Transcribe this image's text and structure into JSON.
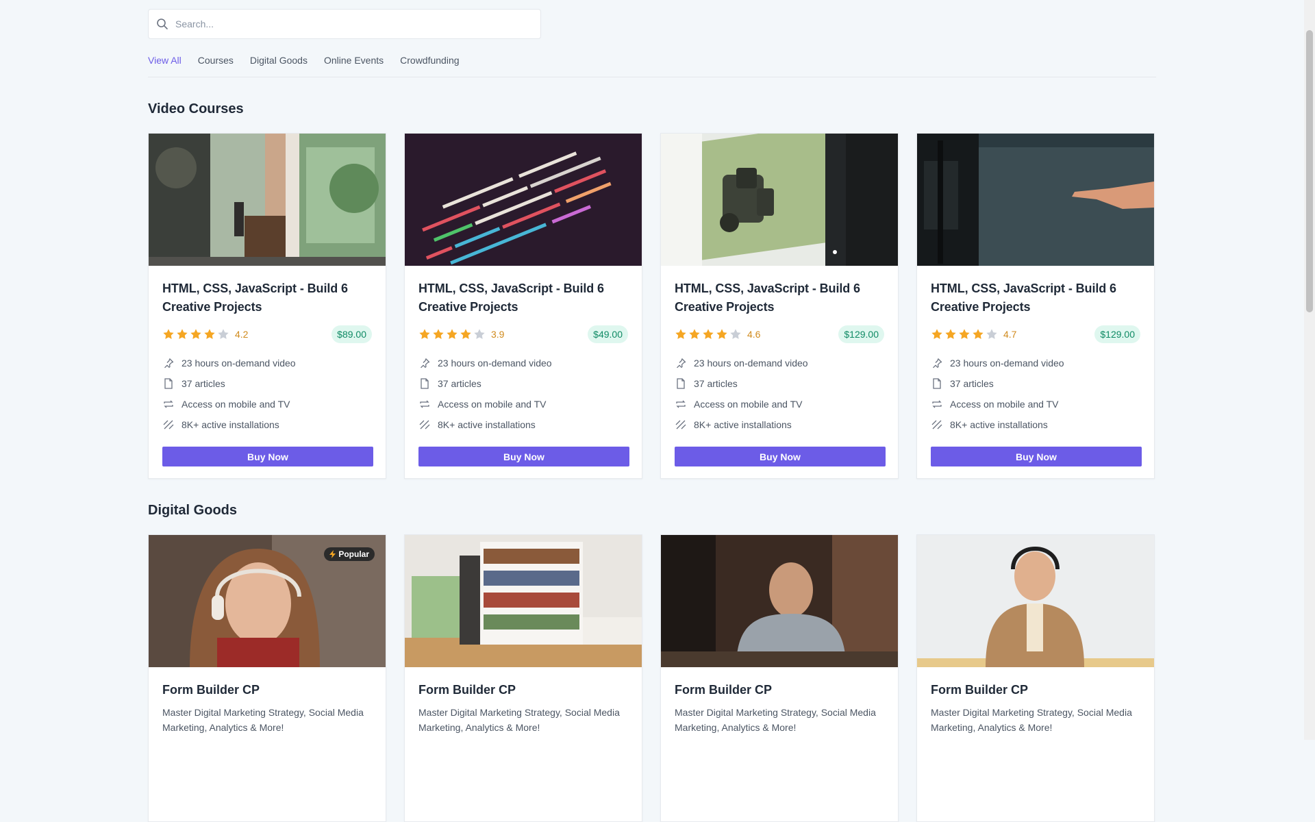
{
  "search": {
    "placeholder": "Search..."
  },
  "tabs": [
    {
      "label": "View All",
      "active": true
    },
    {
      "label": "Courses",
      "active": false
    },
    {
      "label": "Digital Goods",
      "active": false
    },
    {
      "label": "Online Events",
      "active": false
    },
    {
      "label": "Crowdfunding",
      "active": false
    }
  ],
  "video_courses": {
    "title": "Video Courses",
    "features": [
      {
        "icon": "pin-icon",
        "label": "23 hours on-demand video"
      },
      {
        "icon": "document-icon",
        "label": "37 articles"
      },
      {
        "icon": "repeat-icon",
        "label": "Access on mobile and TV"
      },
      {
        "icon": "slashes-icon",
        "label": "8K+ active installations"
      }
    ],
    "buy_label": "Buy Now",
    "cards": [
      {
        "title": "HTML, CSS, JavaScript - Build 6 Creative Projects",
        "rating": "4.2",
        "stars": 4,
        "price": "$89.00",
        "image": "cafe-interior-photo"
      },
      {
        "title": "HTML, CSS, JavaScript - Build 6 Creative Projects",
        "rating": "3.9",
        "stars": 4,
        "price": "$49.00",
        "image": "code-screen-photo"
      },
      {
        "title": "HTML, CSS, JavaScript - Build 6 Creative Projects",
        "rating": "4.6",
        "stars": 4,
        "price": "$129.00",
        "image": "laptop-3d-model-photo"
      },
      {
        "title": "HTML, CSS, JavaScript - Build 6 Creative Projects",
        "rating": "4.7",
        "stars": 4,
        "price": "$129.00",
        "image": "pointing-hand-photo"
      }
    ]
  },
  "digital_goods": {
    "title": "Digital Goods",
    "cards": [
      {
        "title": "Form Builder CP",
        "description": "Master Digital Marketing Strategy, Social Media Marketing, Analytics & More!",
        "badge": "Popular",
        "image": "girl-headphones-photo"
      },
      {
        "title": "Form Builder CP",
        "description": "Master Digital Marketing Strategy, Social Media Marketing, Analytics & More!",
        "image": "bookshelf-room-photo"
      },
      {
        "title": "Form Builder CP",
        "description": "Master Digital Marketing Strategy, Social Media Marketing, Analytics & More!",
        "image": "man-cafe-photo"
      },
      {
        "title": "Form Builder CP",
        "description": "Master Digital Marketing Strategy, Social Media Marketing, Analytics & More!",
        "image": "woman-headphones-photo"
      }
    ]
  },
  "colors": {
    "accent": "#6c5ce7",
    "price_bg": "#dff7ef",
    "price_text": "#0f8a64",
    "star": "#f5a623",
    "star_empty": "#c9ced6",
    "background": "#f3f7fa"
  }
}
